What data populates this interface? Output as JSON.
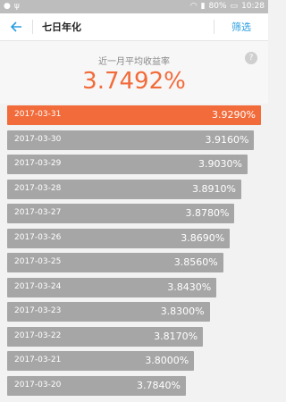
{
  "status_bar": {
    "battery": "80%",
    "time": "10:28"
  },
  "header": {
    "title": "七日年化",
    "filter_label": "筛选"
  },
  "summary": {
    "label": "近一月平均收益率",
    "value": "3.7492%"
  },
  "colors": {
    "accent": "#f26b3a",
    "bar": "#a6a6a6",
    "link": "#2a9de0"
  },
  "rows": [
    {
      "date": "2017-03-31",
      "value_text": "3.9290%",
      "value": 3.929,
      "active": true
    },
    {
      "date": "2017-03-30",
      "value_text": "3.9160%",
      "value": 3.916,
      "active": false
    },
    {
      "date": "2017-03-29",
      "value_text": "3.9030%",
      "value": 3.903,
      "active": false
    },
    {
      "date": "2017-03-28",
      "value_text": "3.8910%",
      "value": 3.891,
      "active": false
    },
    {
      "date": "2017-03-27",
      "value_text": "3.8780%",
      "value": 3.878,
      "active": false
    },
    {
      "date": "2017-03-26",
      "value_text": "3.8690%",
      "value": 3.869,
      "active": false
    },
    {
      "date": "2017-03-25",
      "value_text": "3.8560%",
      "value": 3.856,
      "active": false
    },
    {
      "date": "2017-03-24",
      "value_text": "3.8430%",
      "value": 3.843,
      "active": false
    },
    {
      "date": "2017-03-23",
      "value_text": "3.8300%",
      "value": 3.83,
      "active": false
    },
    {
      "date": "2017-03-22",
      "value_text": "3.8170%",
      "value": 3.817,
      "active": false
    },
    {
      "date": "2017-03-21",
      "value_text": "3.8000%",
      "value": 3.8,
      "active": false
    },
    {
      "date": "2017-03-20",
      "value_text": "3.7840%",
      "value": 3.784,
      "active": false
    }
  ]
}
